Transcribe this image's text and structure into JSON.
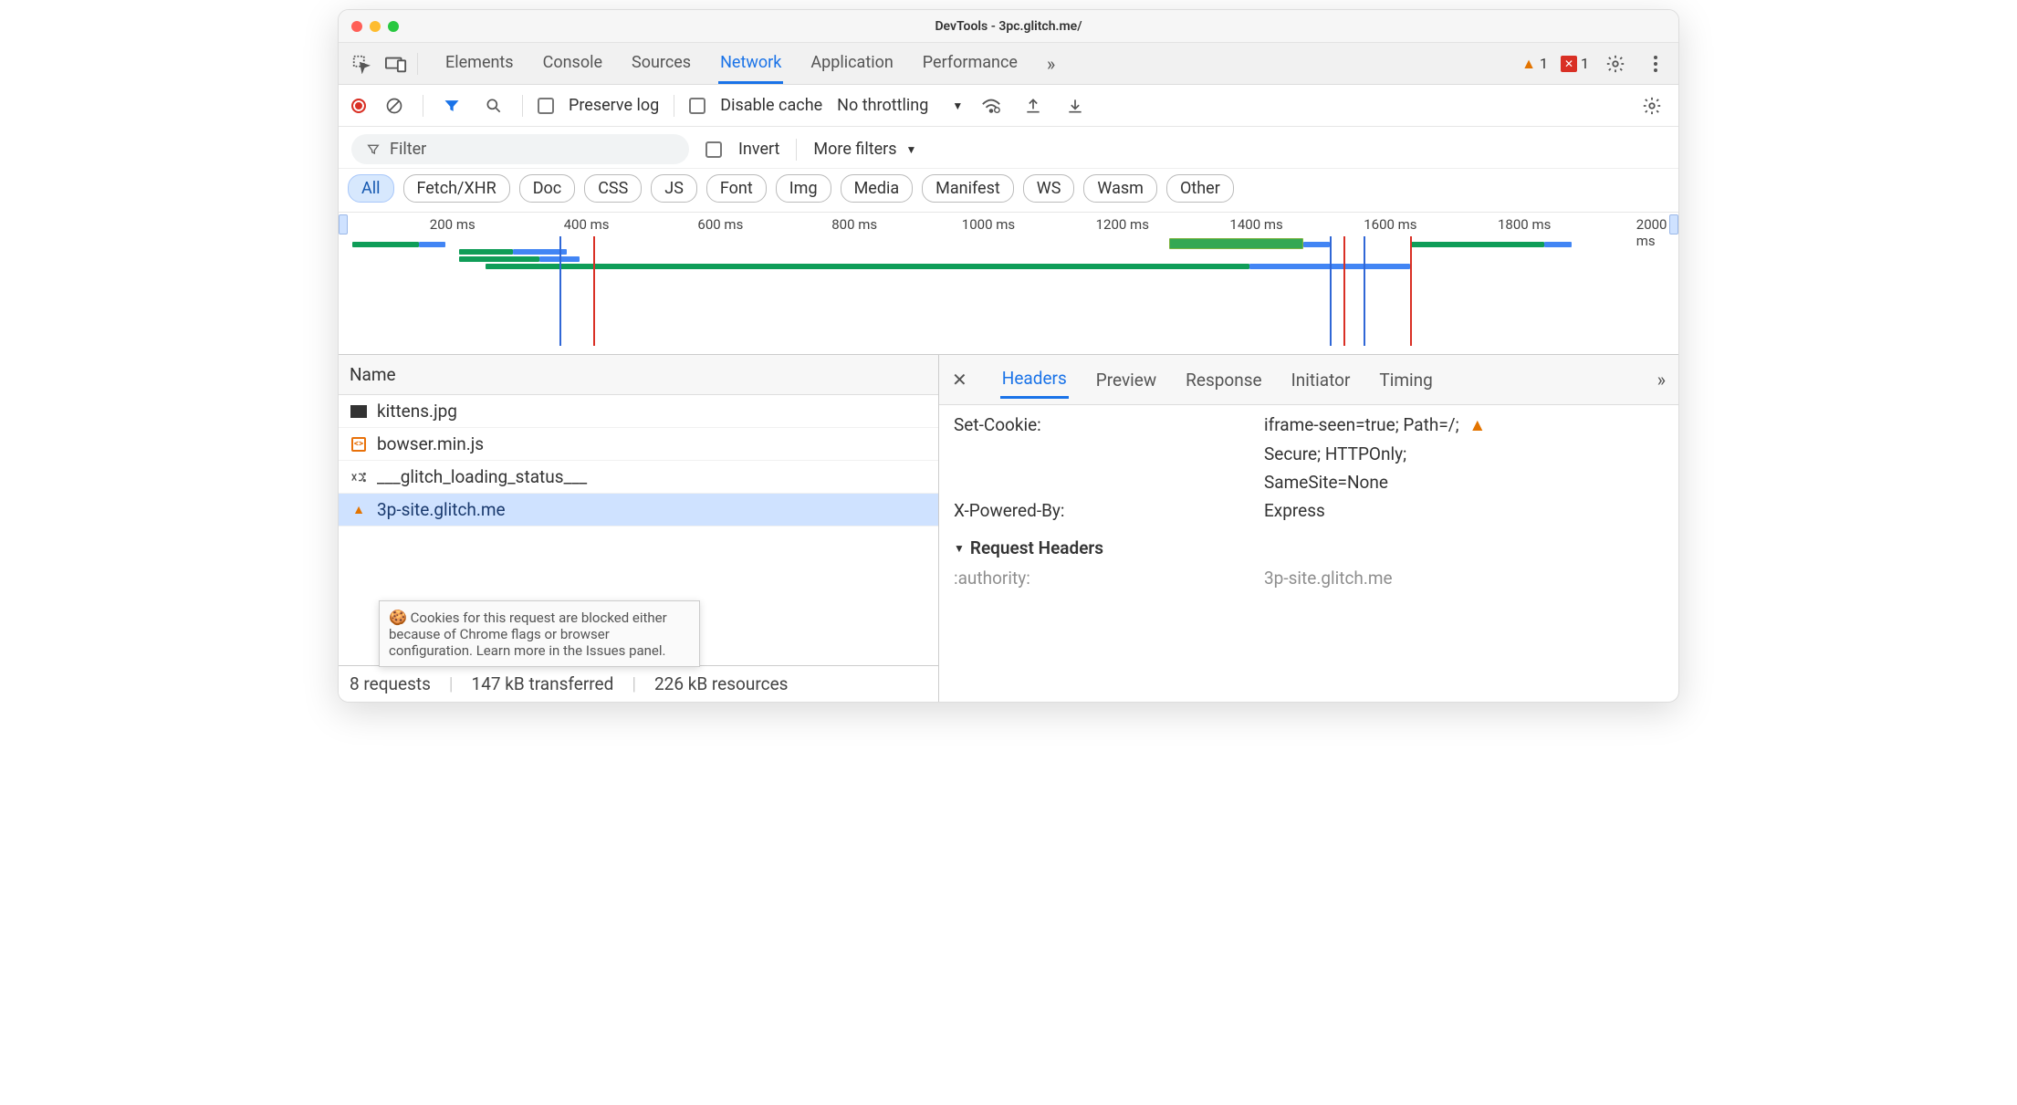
{
  "window": {
    "title": "DevTools - 3pc.glitch.me/"
  },
  "tabs": {
    "items": [
      "Elements",
      "Console",
      "Sources",
      "Network",
      "Application",
      "Performance"
    ],
    "active": "Network",
    "overflow": "»"
  },
  "issues": {
    "warning_count": "1",
    "error_count": "1"
  },
  "toolbar": {
    "preserve_log": "Preserve log",
    "disable_cache": "Disable cache",
    "throttling": "No throttling"
  },
  "filters": {
    "placeholder": "Filter",
    "invert": "Invert",
    "more": "More filters"
  },
  "type_chips": [
    "All",
    "Fetch/XHR",
    "Doc",
    "CSS",
    "JS",
    "Font",
    "Img",
    "Media",
    "Manifest",
    "WS",
    "Wasm",
    "Other"
  ],
  "type_active": "All",
  "timeline": {
    "ticks": [
      "200 ms",
      "400 ms",
      "600 ms",
      "800 ms",
      "1000 ms",
      "1200 ms",
      "1400 ms",
      "1600 ms",
      "1800 ms",
      "2000 ms"
    ]
  },
  "requests": {
    "header": "Name",
    "rows": [
      {
        "icon": "image",
        "name": "kittens.jpg",
        "selected": false
      },
      {
        "icon": "js",
        "name": "bowser.min.js",
        "selected": false
      },
      {
        "icon": "ws",
        "name": "___glitch_loading_status___",
        "selected": false
      },
      {
        "icon": "warn",
        "name": "3p-site.glitch.me",
        "selected": true
      }
    ]
  },
  "tooltip": {
    "text": "Cookies for this request are blocked either because of Chrome flags or browser configuration. Learn more in the Issues panel."
  },
  "status": {
    "requests": "8 requests",
    "transferred": "147 kB transferred",
    "resources": "226 kB resources"
  },
  "detail": {
    "tabs": [
      "Headers",
      "Preview",
      "Response",
      "Initiator",
      "Timing"
    ],
    "active": "Headers",
    "overflow": "»",
    "headers": {
      "set_cookie_key": "Set-Cookie:",
      "set_cookie_val1": "iframe-seen=true; Path=/;",
      "set_cookie_val2": "Secure; HTTPOnly;",
      "set_cookie_val3": "SameSite=None",
      "xpb_key": "X-Powered-By:",
      "xpb_val": "Express",
      "req_section": "Request Headers",
      "authority_key": ":authority:",
      "authority_val": "3p-site.glitch.me"
    }
  }
}
